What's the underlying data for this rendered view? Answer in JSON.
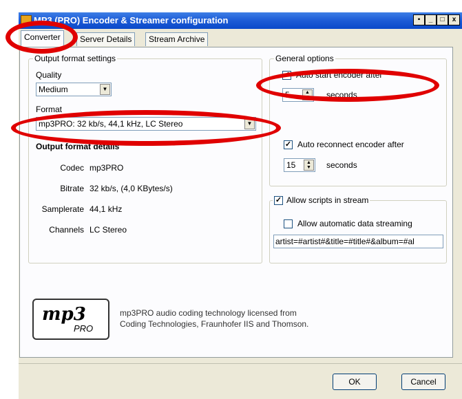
{
  "window": {
    "title": "MP3 (PRO) Encoder & Streamer configuration",
    "controls": [
      "▪",
      "_",
      "□",
      "x"
    ]
  },
  "tabs": [
    {
      "label": "Converter",
      "active": true
    },
    {
      "label": "Server Details",
      "active": false
    },
    {
      "label": "Stream Archive",
      "active": false
    }
  ],
  "output_settings": {
    "group_title": "Output format settings",
    "quality_label": "Quality",
    "quality_value": "Medium",
    "format_label": "Format",
    "format_value": "mp3PRO: 32 kb/s, 44,1 kHz, LC Stereo",
    "details_title": "Output format details",
    "details": [
      {
        "label": "Codec",
        "value": "mp3PRO"
      },
      {
        "label": "Bitrate",
        "value": "32 kb/s, (4,0 KBytes/s)"
      },
      {
        "label": "Samplerate",
        "value": "44,1 kHz"
      },
      {
        "label": "Channels",
        "value": "LC Stereo"
      }
    ]
  },
  "general_options": {
    "group_title": "General options",
    "auto_start_label": "Auto start encoder after",
    "auto_start_checked": true,
    "auto_start_seconds": "5",
    "seconds_label": "seconds",
    "auto_reconnect_label": "Auto reconnect encoder after",
    "auto_reconnect_checked": true,
    "auto_reconnect_seconds": "15",
    "seconds_label_2": "seconds"
  },
  "scripts": {
    "allow_scripts_label": "Allow scripts in stream",
    "allow_scripts_checked": true,
    "allow_data_label": "Allow automatic data streaming",
    "allow_data_checked": false,
    "template_value": "artist=#artist#&title=#title#&album=#al"
  },
  "logo": {
    "main": "mp3",
    "sub": "PRO"
  },
  "license_text": {
    "line1": "mp3PRO audio coding technology licensed from",
    "line2": "Coding Technologies, Fraunhofer IIS and Thomson."
  },
  "buttons": {
    "ok": "OK",
    "cancel": "Cancel"
  },
  "colors": {
    "titlebar": "#0a49c9",
    "callout": "#e00000",
    "dialog": "#ece9d8"
  }
}
